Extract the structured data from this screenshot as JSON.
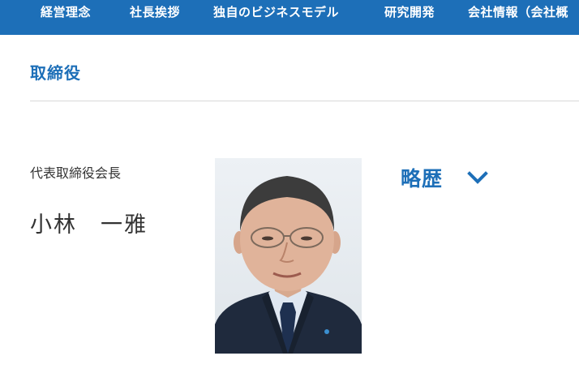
{
  "nav": {
    "items": [
      "経営理念",
      "社長挨拶",
      "独自のビジネスモデル",
      "研究開発",
      "会社情報（会社概"
    ],
    "current_index": 4
  },
  "section": {
    "title": "取締役"
  },
  "director": {
    "role": "代表取締役会長",
    "name": "小林　一雅",
    "bio_label": "略歴"
  },
  "icons": {
    "chevron": "chevron-down-icon"
  },
  "colors": {
    "brand": "#1d6fb8",
    "text": "#333333",
    "divider": "#d9d9d9"
  }
}
